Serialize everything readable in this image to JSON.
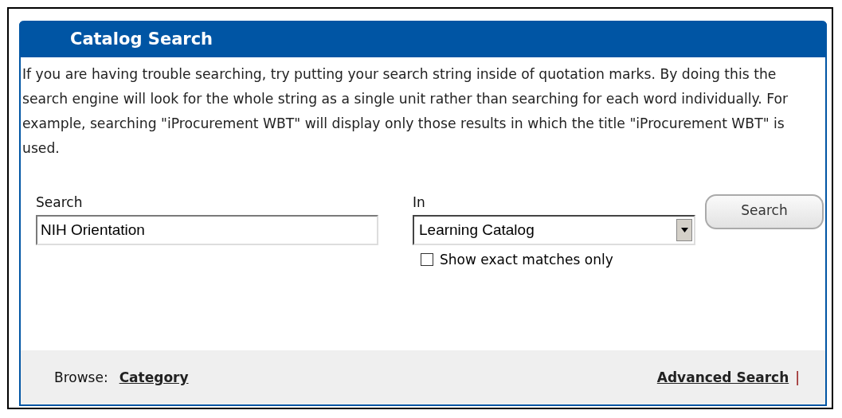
{
  "panel": {
    "title": "Catalog Search",
    "help_text": "If you are having trouble searching, try putting your search string inside of quotation marks. By doing this the search engine will look for the whole string as a single unit rather than searching for each word individually. For example, searching \"iProcurement WBT\" will display only those results in which the title \"iProcurement WBT\" is used."
  },
  "search": {
    "label": "Search",
    "value": "NIH Orientation"
  },
  "scope": {
    "label": "In",
    "value": "Learning Catalog"
  },
  "exact_matches": {
    "label": "Show exact matches only",
    "checked": false
  },
  "search_button": "Search",
  "footer": {
    "browse_label": "Browse:",
    "browse_link": "Category",
    "advanced_link": "Advanced Search",
    "separator": "|"
  }
}
